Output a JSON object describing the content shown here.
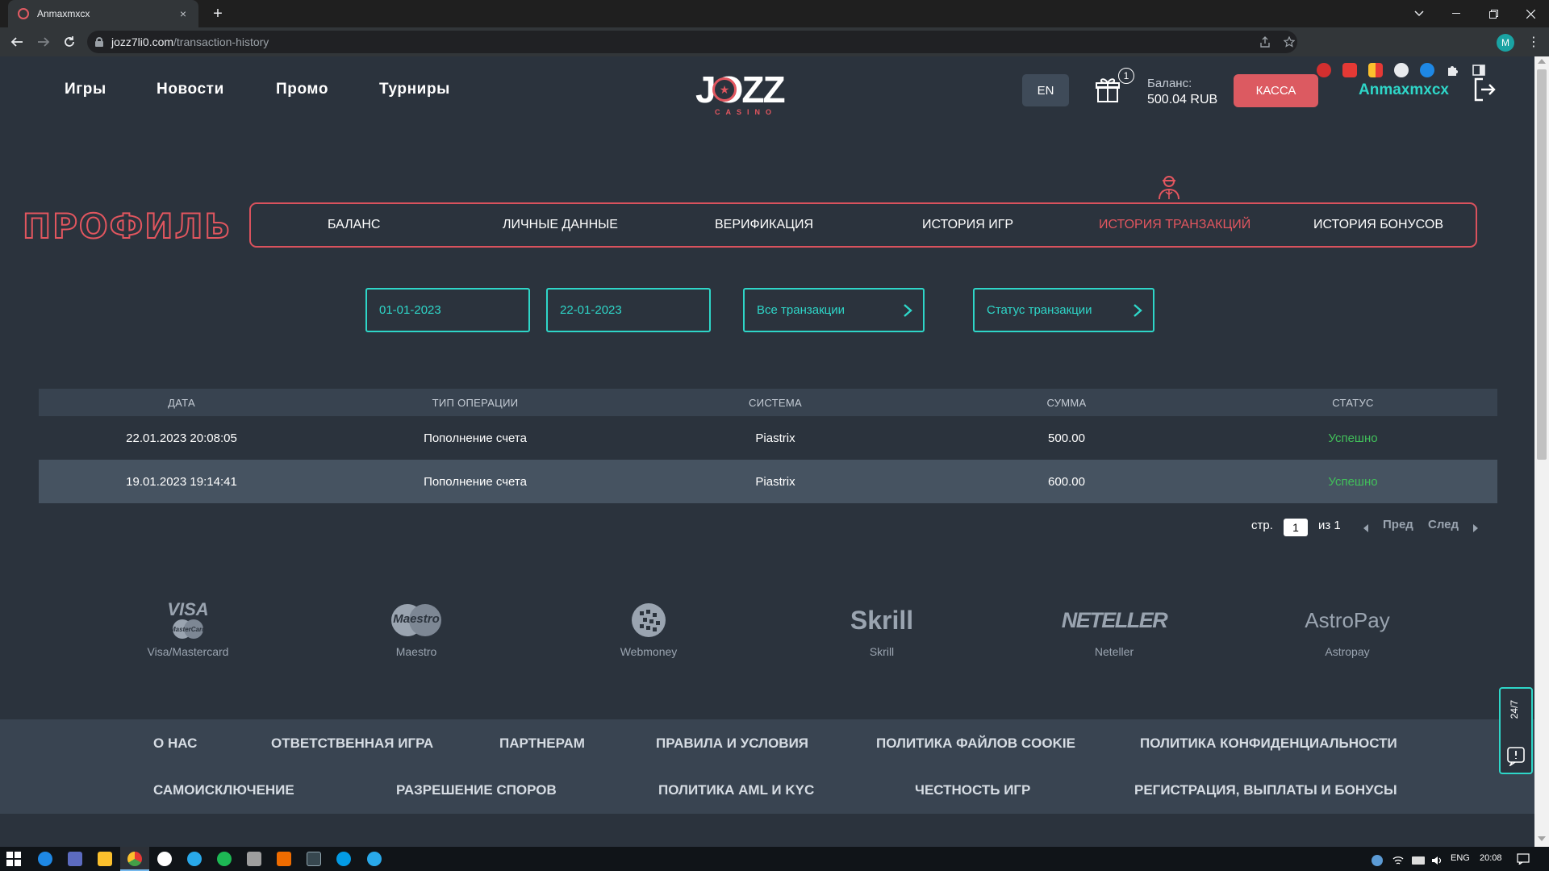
{
  "browser": {
    "tab_title": "Anmaxmxcx",
    "tab_close_icon": "×",
    "new_tab_icon": "+",
    "url_host": "jozz7li0.com",
    "url_path": "/transaction-history",
    "profile_initial": "M"
  },
  "header": {
    "nav": [
      "Игры",
      "Новости",
      "Промо",
      "Турниры"
    ],
    "logo_text": "JOZZ",
    "logo_sub": "CASINO",
    "lang": "EN",
    "gift_count": "1",
    "balance_label": "Баланс:",
    "balance_value": "500.04  RUB",
    "kassa_label": "КАССА",
    "username": "Anmaxmxcx"
  },
  "profile": {
    "title": "ПРОФИЛЬ",
    "tabs": [
      "БАЛАНС",
      "ЛИЧНЫЕ ДАННЫЕ",
      "ВЕРИФИКАЦИЯ",
      "ИСТОРИЯ ИГР",
      "ИСТОРИЯ ТРАНЗАКЦИЙ",
      "ИСТОРИЯ БОНУСОВ"
    ],
    "active_tab": "ИСТОРИЯ ТРАНЗАКЦИЙ"
  },
  "filters": {
    "date_from": "01-01-2023",
    "date_to": "22-01-2023",
    "type": "Все транзакции",
    "status": "Статус транзакции"
  },
  "table": {
    "headers": [
      "ДАТА",
      "ТИП ОПЕРАЦИИ",
      "СИСТЕМА",
      "СУММА",
      "СТАТУС"
    ],
    "rows": [
      [
        "22.01.2023 20:08:05",
        "Пополнение счета",
        "Piastrix",
        "500.00",
        "Успешно"
      ],
      [
        "19.01.2023 19:14:41",
        "Пополнение счета",
        "Piastrix",
        "600.00",
        "Успешно"
      ]
    ]
  },
  "pagination": {
    "page_label": "стр.",
    "page": "1",
    "of_label": "из 1",
    "prev": "Пред",
    "next": "След"
  },
  "payments": [
    {
      "logo": "VISA",
      "label": "Visa/Mastercard"
    },
    {
      "logo": "Maestro",
      "label": "Maestro"
    },
    {
      "logo": "",
      "label": "Webmoney"
    },
    {
      "logo": "Skrill",
      "label": "Skrill"
    },
    {
      "logo": "NETELLER",
      "label": "Neteller"
    },
    {
      "logo": "AstroPay",
      "label": "Astropay"
    }
  ],
  "footer": {
    "row1": [
      "О НАС",
      "ОТВЕТСТВЕННАЯ ИГРА",
      "ПАРТНЕРАМ",
      "ПРАВИЛА И УСЛОВИЯ",
      "ПОЛИТИКА ФАЙЛОВ COOKIE",
      "ПОЛИТИКА КОНФИДЕНЦИАЛЬНОСТИ"
    ],
    "row2": [
      "САМОИСКЛЮЧЕНИЕ",
      "РАЗРЕШЕНИЕ СПОРОВ",
      "ПОЛИТИКА AML И KYC",
      "ЧЕСТНОСТЬ ИГР",
      "РЕГИСТРАЦИЯ, ВЫПЛАТЫ И БОНУСЫ"
    ]
  },
  "support": {
    "label": "24/7"
  },
  "taskbar": {
    "lang": "ENG",
    "time": "20:08"
  },
  "colors": {
    "accent_teal": "#2ed6c8",
    "accent_red": "#e2565f",
    "background": "#2b333d",
    "success": "#41c05a"
  }
}
